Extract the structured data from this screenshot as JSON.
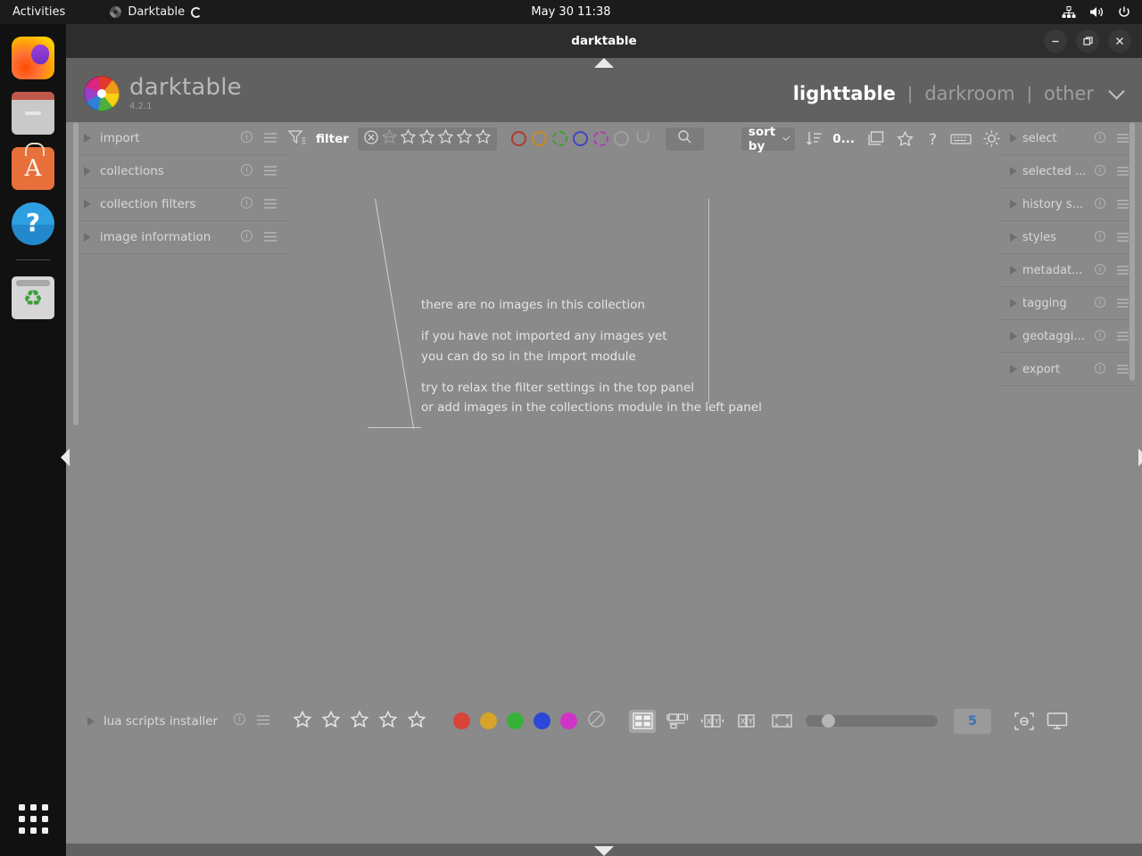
{
  "desktop": {
    "activities_label": "Activities",
    "app_name": "Darktable",
    "clock": "May 30  11:38",
    "tray_icons": [
      "network-icon",
      "volume-icon",
      "power-icon"
    ],
    "dock_items": [
      {
        "name": "firefox-icon",
        "label": "Firefox"
      },
      {
        "name": "files-icon",
        "label": "Files"
      },
      {
        "name": "ubuntu-software-icon",
        "label": "Ubuntu Software"
      },
      {
        "name": "help-icon",
        "label": "Help"
      },
      {
        "name": "trash-icon",
        "label": "Trash"
      }
    ],
    "show_apps_label": "Show Applications"
  },
  "window": {
    "title": "darktable",
    "minimize_label": "minimize",
    "maximize_label": "maximize",
    "close_label": "close"
  },
  "brand": {
    "name": "darktable",
    "version": "4.2.1"
  },
  "viewnav": {
    "items": [
      {
        "label": "lighttable",
        "active": true
      },
      {
        "label": "darkroom",
        "active": false
      },
      {
        "label": "other",
        "active": false
      }
    ],
    "separator": "|"
  },
  "left_panel": {
    "modules": [
      {
        "label": "import"
      },
      {
        "label": "collections"
      },
      {
        "label": "collection filters"
      },
      {
        "label": "image information"
      }
    ],
    "bottom_module": {
      "label": "lua scripts installer"
    }
  },
  "right_panel": {
    "modules": [
      {
        "label": "select"
      },
      {
        "label": "selected ..."
      },
      {
        "label": "history s..."
      },
      {
        "label": "styles"
      },
      {
        "label": "metadat..."
      },
      {
        "label": "tagging"
      },
      {
        "label": "geotaggi..."
      },
      {
        "label": "export"
      }
    ]
  },
  "filter_bar": {
    "funnel_icon": "filter-funnel-icon",
    "label": "filter",
    "reject_icon": "reject-circle-x-icon",
    "star_count": 5,
    "color_labels": [
      {
        "name": "color-label-red",
        "color": "#b03a32"
      },
      {
        "name": "color-label-yellow",
        "color": "#c98b22"
      },
      {
        "name": "color-label-green",
        "color": "#3f9e34",
        "dashed": true
      },
      {
        "name": "color-label-blue",
        "color": "#4246c4"
      },
      {
        "name": "color-label-purple",
        "color": "#b43ab4",
        "dashed": true
      },
      {
        "name": "color-label-gray",
        "color": "#a0a0a0"
      }
    ],
    "color_union_icon": "color-label-union-icon",
    "search_icon": "search-icon",
    "sort_by_label": "sort by",
    "sort_direction_icon": "sort-descending-icon",
    "sort_value": "0...",
    "grouping_icon": "grouping-stack-icon",
    "overlays_icon": "star-overlays-icon",
    "help_icon": "help-question-icon",
    "shortcuts_icon": "keyboard-shortcuts-icon",
    "preferences_icon": "gear-preferences-icon"
  },
  "center": {
    "message_lines": [
      "there are no images in this collection",
      "if you have not imported any images yet",
      "you can do so in the import module",
      "try to relax the filter settings in the top panel",
      "or add images in the collections module in the left panel"
    ]
  },
  "bottom_bar": {
    "star_count": 5,
    "color_dots": [
      {
        "name": "color-dot-red",
        "color": "#d8433a"
      },
      {
        "name": "color-dot-yellow",
        "color": "#d8a32a"
      },
      {
        "name": "color-dot-green",
        "color": "#36b23a"
      },
      {
        "name": "color-dot-blue",
        "color": "#2c48d8"
      },
      {
        "name": "color-dot-magenta",
        "color": "#cf34c7"
      }
    ],
    "clear_labels_icon": "clear-color-labels-icon",
    "view_modes": [
      {
        "name": "filemanager-view-icon",
        "active": true
      },
      {
        "name": "zoomable-lighttable-view-icon",
        "active": false
      },
      {
        "name": "culling-dynamic-view-icon",
        "active": false
      },
      {
        "name": "culling-fixed-view-icon",
        "active": false
      },
      {
        "name": "full-preview-view-icon",
        "active": false
      }
    ],
    "zoom_slider_value": 5,
    "zoom_value_text": "5",
    "focus_detection_icon": "focus-detection-icon",
    "display_profile_icon": "display-profile-icon"
  },
  "collapse_arrows": {
    "top": "collapse-top-panel-arrow",
    "bottom": "collapse-bottom-panel-arrow",
    "left": "collapse-left-panel-arrow",
    "right": "collapse-right-panel-arrow"
  }
}
